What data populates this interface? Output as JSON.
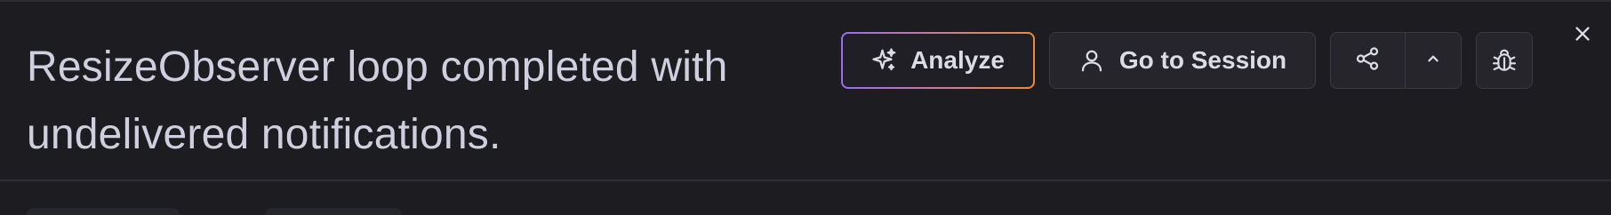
{
  "error": {
    "title": "ResizeObserver loop completed with undelivered notifications."
  },
  "actions": {
    "analyze_label": "Analyze",
    "session_label": "Go to Session"
  },
  "icons": {
    "analyze": "sparkles-icon",
    "session": "user-icon",
    "share": "share-icon",
    "expand": "chevron-up-icon",
    "bug": "bug-icon",
    "close": "close-icon"
  },
  "colors": {
    "background": "#1c1c21",
    "text": "#cfcfe0",
    "button_bg": "#25252b",
    "button_border": "#3b3b44",
    "analyze_gradient_start": "#9b6cf5",
    "analyze_gradient_end": "#f08a3a"
  }
}
